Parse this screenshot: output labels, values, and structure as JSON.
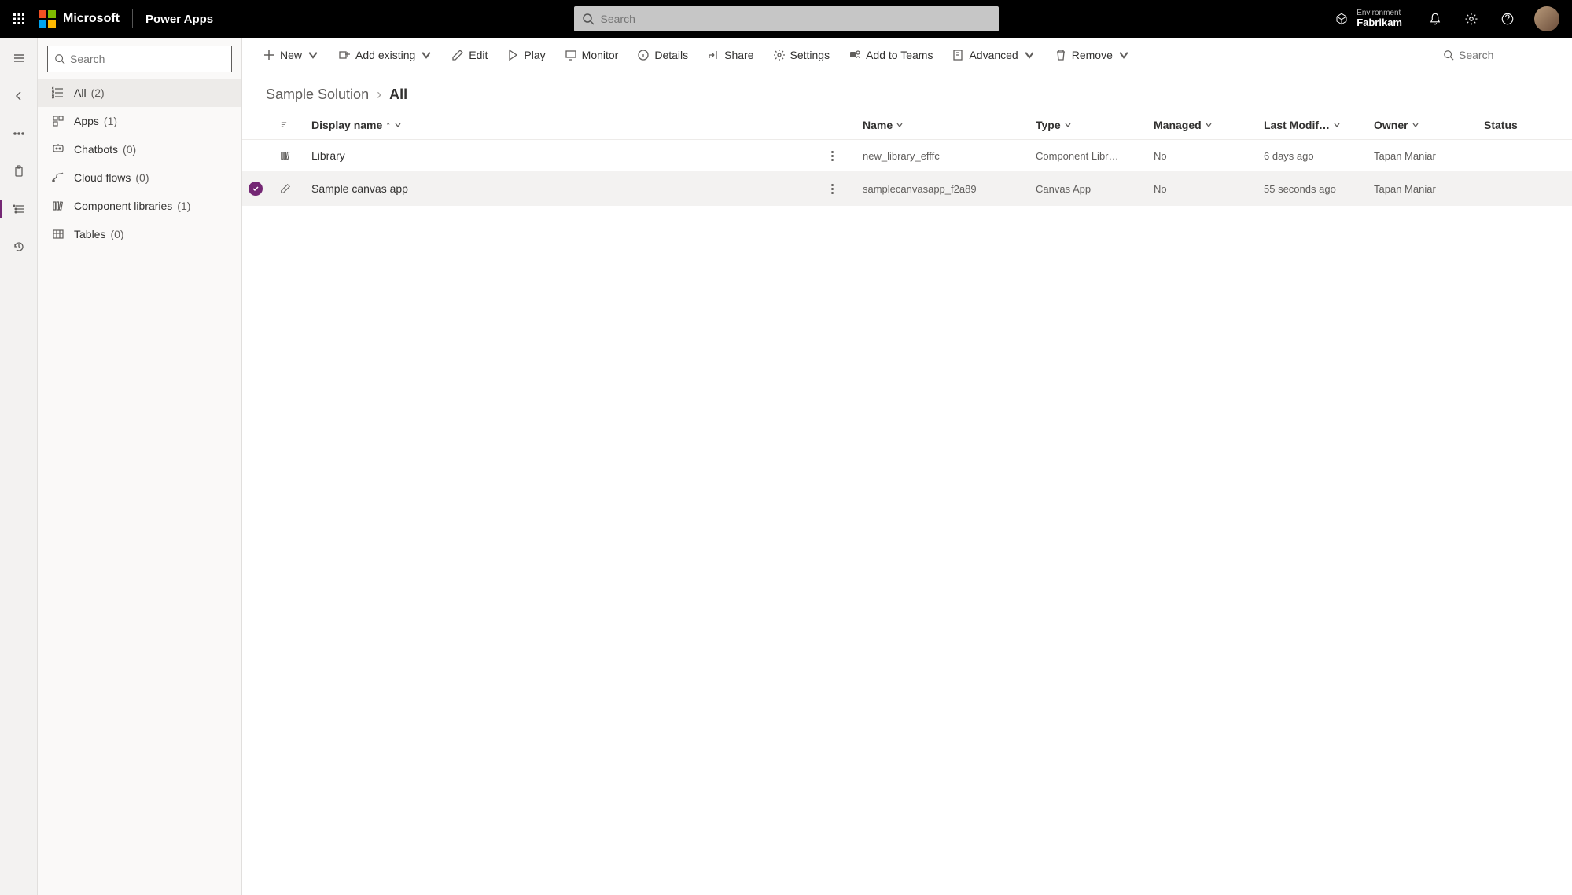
{
  "header": {
    "brand": "Microsoft",
    "app": "Power Apps",
    "search_placeholder": "Search",
    "env_label": "Environment",
    "env_name": "Fabrikam"
  },
  "nav": {
    "search_placeholder": "Search",
    "items": [
      {
        "label": "All",
        "count": "(2)",
        "icon": "list"
      },
      {
        "label": "Apps",
        "count": "(1)",
        "icon": "apps"
      },
      {
        "label": "Chatbots",
        "count": "(0)",
        "icon": "chat"
      },
      {
        "label": "Cloud flows",
        "count": "(0)",
        "icon": "flow"
      },
      {
        "label": "Component libraries",
        "count": "(1)",
        "icon": "lib"
      },
      {
        "label": "Tables",
        "count": "(0)",
        "icon": "table"
      }
    ]
  },
  "cmd": {
    "new": "New",
    "add_existing": "Add existing",
    "edit": "Edit",
    "play": "Play",
    "monitor": "Monitor",
    "details": "Details",
    "share": "Share",
    "settings": "Settings",
    "add_to_teams": "Add to Teams",
    "advanced": "Advanced",
    "remove": "Remove",
    "search_placeholder": "Search"
  },
  "breadcrumb": {
    "parent": "Sample Solution",
    "current": "All"
  },
  "table": {
    "cols": {
      "display_name": "Display name",
      "name": "Name",
      "type": "Type",
      "managed": "Managed",
      "last_modified": "Last Modif…",
      "owner": "Owner",
      "status": "Status"
    },
    "rows": [
      {
        "display_name": "Library",
        "name": "new_library_efffc",
        "type": "Component Libr…",
        "managed": "No",
        "last_modified": "6 days ago",
        "owner": "Tapan Maniar",
        "status": "",
        "selected": false
      },
      {
        "display_name": "Sample canvas app",
        "name": "samplecanvasapp_f2a89",
        "type": "Canvas App",
        "managed": "No",
        "last_modified": "55 seconds ago",
        "owner": "Tapan Maniar",
        "status": "",
        "selected": true
      }
    ]
  }
}
